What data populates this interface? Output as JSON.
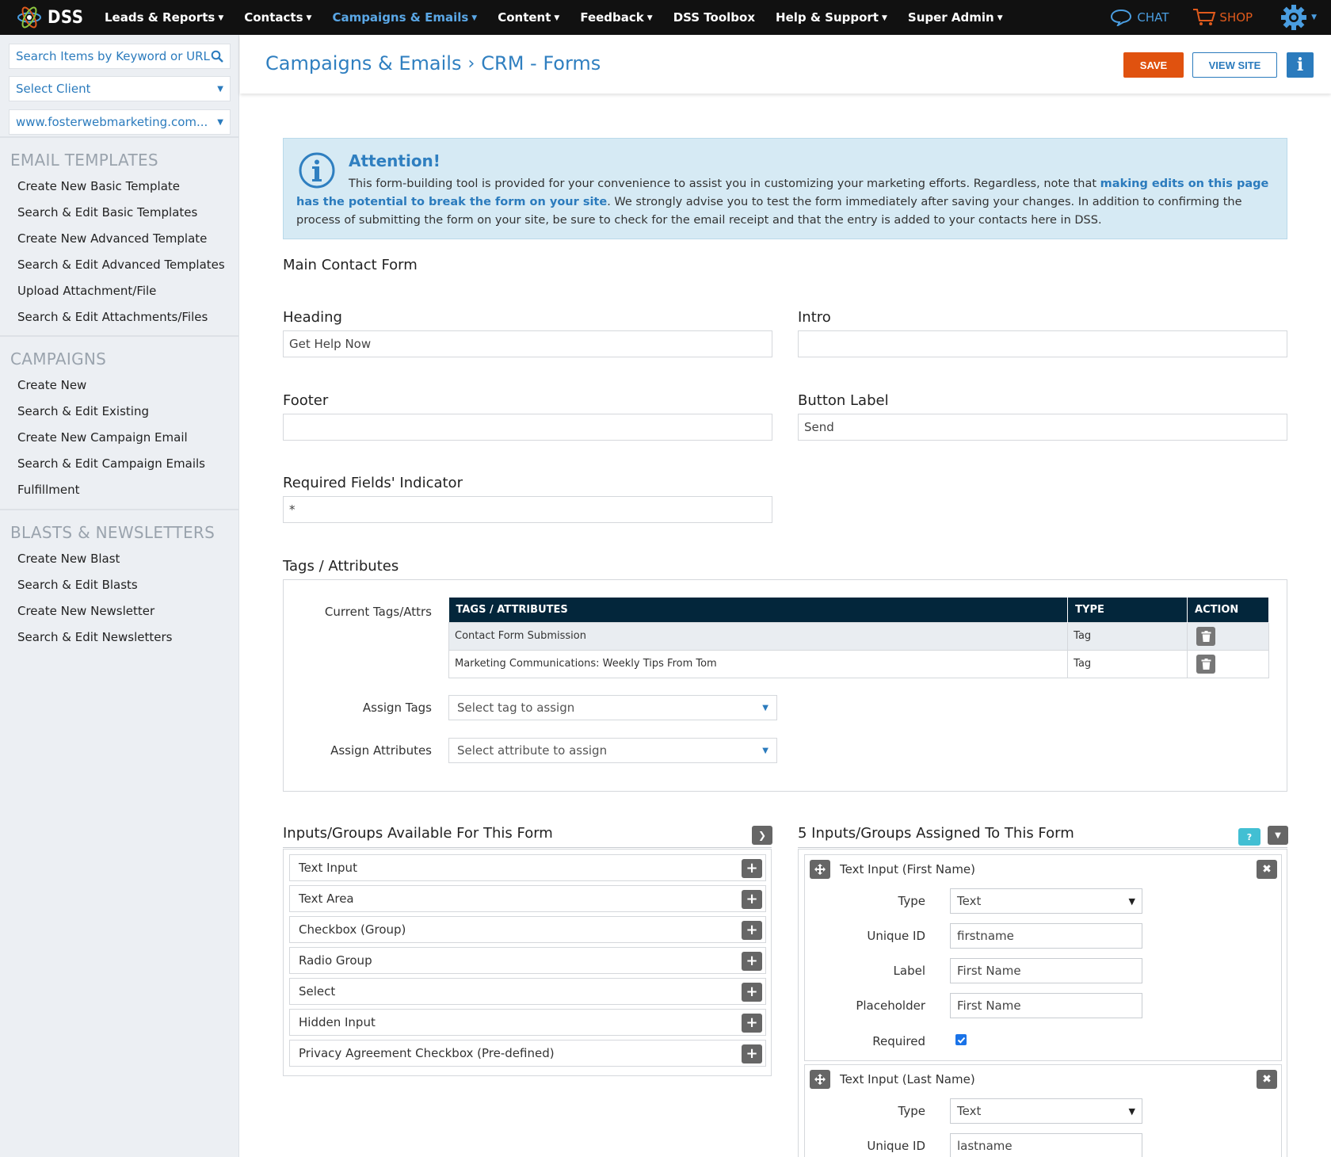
{
  "topnav": {
    "logo_text": "DSS",
    "menu": [
      {
        "label": "Leads & Reports",
        "caret": true,
        "active": false
      },
      {
        "label": "Contacts",
        "caret": true,
        "active": false
      },
      {
        "label": "Campaigns & Emails",
        "caret": true,
        "active": true
      },
      {
        "label": "Content",
        "caret": true,
        "active": false
      },
      {
        "label": "Feedback",
        "caret": true,
        "active": false
      },
      {
        "label": "DSS Toolbox",
        "caret": false,
        "active": false
      },
      {
        "label": "Help & Support",
        "caret": true,
        "active": false
      },
      {
        "label": "Super Admin",
        "caret": true,
        "active": false
      }
    ],
    "chat_label": "CHAT",
    "shop_label": "SHOP",
    "accent": "#4a9de0",
    "shop_color": "#e05a1c"
  },
  "sidebar": {
    "search_placeholder": "Search Items by Keyword or URL",
    "client_select": "Select Client",
    "site_select": "www.fosterwebmarketing.com...",
    "sections": [
      {
        "title": "EMAIL TEMPLATES",
        "links": [
          "Create New Basic Template",
          "Search & Edit Basic Templates",
          "Create New Advanced Template",
          "Search & Edit Advanced Templates",
          "Upload Attachment/File",
          "Search & Edit Attachments/Files"
        ]
      },
      {
        "title": "CAMPAIGNS",
        "links": [
          "Create New",
          "Search & Edit Existing",
          "Create New Campaign Email",
          "Search & Edit Campaign Emails",
          "Fulfillment"
        ]
      },
      {
        "title": "BLASTS & NEWSLETTERS",
        "links": [
          "Create New Blast",
          "Search & Edit Blasts",
          "Create New Newsletter",
          "Search & Edit Newsletters"
        ]
      }
    ]
  },
  "header": {
    "crumb_parent": "Campaigns & Emails",
    "crumb_sep": "›",
    "crumb_current": "CRM - Forms",
    "save_label": "SAVE",
    "view_site_label": "VIEW SITE",
    "info_label": "i",
    "save_color": "#e0520f",
    "primary_color": "#2b7bbd"
  },
  "attention": {
    "title": "Attention!",
    "text_before": "This form-building tool is provided for your convenience to assist you in customizing your marketing efforts. Regardless, note that ",
    "text_bold": "making edits on this page has the potential to break the form on your site",
    "text_after": ". We strongly advise you to test the form immediately after saving your changes. In addition to confirming the process of submitting the form on your site, be sure to check for the email receipt and that the entry is added to your contacts here in DSS."
  },
  "form": {
    "name": "Main Contact Form",
    "heading_label": "Heading",
    "heading_value": "Get Help Now",
    "intro_label": "Intro",
    "intro_value": "",
    "footer_label": "Footer",
    "footer_value": "",
    "button_label_label": "Button Label",
    "button_label_value": "Send",
    "required_label": "Required Fields' Indicator",
    "required_value": "*"
  },
  "tags": {
    "section_title": "Tags / Attributes",
    "current_label": "Current Tags/Attrs",
    "columns": [
      "TAGS / ATTRIBUTES",
      "TYPE",
      "ACTION"
    ],
    "rows": [
      {
        "name": "Contact Form Submission",
        "type": "Tag"
      },
      {
        "name": "Marketing Communications: Weekly Tips From Tom",
        "type": "Tag"
      }
    ],
    "assign_tags_label": "Assign Tags",
    "assign_tags_placeholder": "Select tag to assign",
    "assign_attrs_label": "Assign Attributes",
    "assign_attrs_placeholder": "Select attribute to assign"
  },
  "available": {
    "title": "Inputs/Groups Available For This Form",
    "items": [
      "Text Input",
      "Text Area",
      "Checkbox (Group)",
      "Radio Group",
      "Select",
      "Hidden Input",
      "Privacy Agreement Checkbox (Pre-defined)"
    ]
  },
  "assigned": {
    "title": "5 Inputs/Groups Assigned To This Form",
    "help_label": "?",
    "cards": [
      {
        "title": "Text Input (First Name)",
        "type_label": "Type",
        "type_value": "Text",
        "uid_label": "Unique ID",
        "uid_value": "firstname",
        "label_label": "Label",
        "label_value": "First Name",
        "placeholder_label": "Placeholder",
        "placeholder_value": "First Name",
        "required_label": "Required",
        "required": true
      },
      {
        "title": "Text Input (Last Name)",
        "type_label": "Type",
        "type_value": "Text",
        "uid_label": "Unique ID",
        "uid_value": "lastname"
      }
    ]
  }
}
